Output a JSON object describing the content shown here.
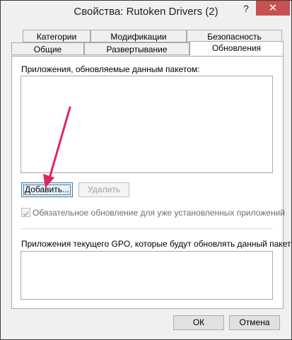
{
  "window": {
    "title": "Свойства: Rutoken Drivers (2)",
    "help_label": "?",
    "close_label": "✕"
  },
  "tabs": {
    "row1": [
      "Категории",
      "Модификации",
      "Безопасность"
    ],
    "row2": [
      "Общие",
      "Развертывание",
      "Обновления"
    ],
    "active": "Обновления"
  },
  "updates": {
    "apps_label": "Приложения, обновляемые данным пакетом:",
    "add_button": "Добавить...",
    "remove_button": "Удалить",
    "mandatory_label": "Обязательное обновление для уже установленных приложений",
    "mandatory_checked": true,
    "gpo_label": "Приложения текущего GPO, которые будут обновлять данный пакет:"
  },
  "footer": {
    "ok_button": "ОК",
    "cancel_button": "Отмена"
  },
  "colors": {
    "annotation_arrow": "#e0245e",
    "close_button": "#c75050"
  }
}
